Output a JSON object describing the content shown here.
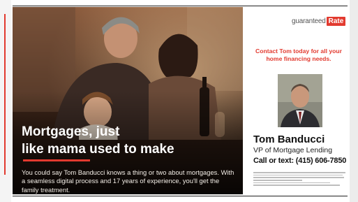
{
  "ad": {
    "headline_lines": [
      "Mortgages, just",
      "like mama used to make"
    ],
    "body": "You could say Tom Banducci knows a thing or two about mortgages. With a seamless digital process and 17 years of experience, you'll get the family treatment.",
    "logo_text": "guaranteed",
    "logo_box": "Rate",
    "cta": "Contact Tom today for all your home financing needs.",
    "name": "Tom Banducci",
    "title": "VP of Mortgage Lending",
    "phone": "Call or text: (415) 606-7850"
  },
  "colors": {
    "brand_red": "#e23a2f"
  },
  "icons": [
    "family-photo",
    "agent-portrait"
  ]
}
